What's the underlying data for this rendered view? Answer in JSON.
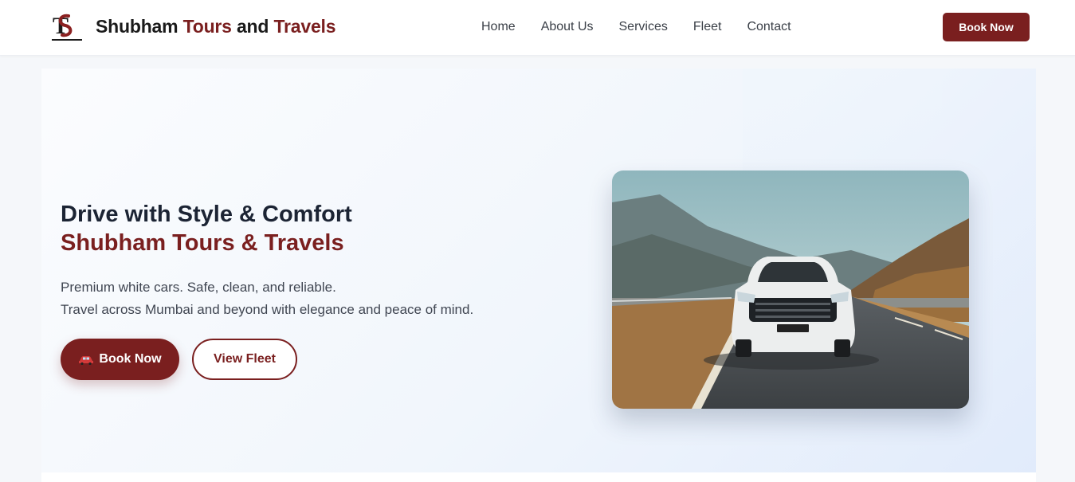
{
  "header": {
    "brand_first": "Shubham ",
    "brand_second": "Tours",
    "brand_third": " and ",
    "brand_fourth": "Travels",
    "logo_icon": "st-monogram-logo",
    "book_label": "Book Now"
  },
  "nav": {
    "items": [
      {
        "label": "Home"
      },
      {
        "label": "About Us"
      },
      {
        "label": "Services"
      },
      {
        "label": "Fleet"
      },
      {
        "label": "Contact"
      }
    ]
  },
  "hero": {
    "title_line1": "Drive with Style & Comfort",
    "title_line2": "Shubham Tours & Travels",
    "subtitle_line1": "Premium white cars. Safe, clean, and reliable.",
    "subtitle_line2": "Travel across Mumbai and beyond with elegance and peace of mind.",
    "primary_button": "Book Now",
    "primary_button_icon": "car-icon",
    "secondary_button": "View Fleet",
    "image_subject": "white-suv-on-mountain-road"
  },
  "colors": {
    "brand_red": "#7a1f1f",
    "text_dark": "#1c2434",
    "hero_bg_start": "#fbfcfe",
    "hero_bg_end": "#e1ebfb"
  }
}
